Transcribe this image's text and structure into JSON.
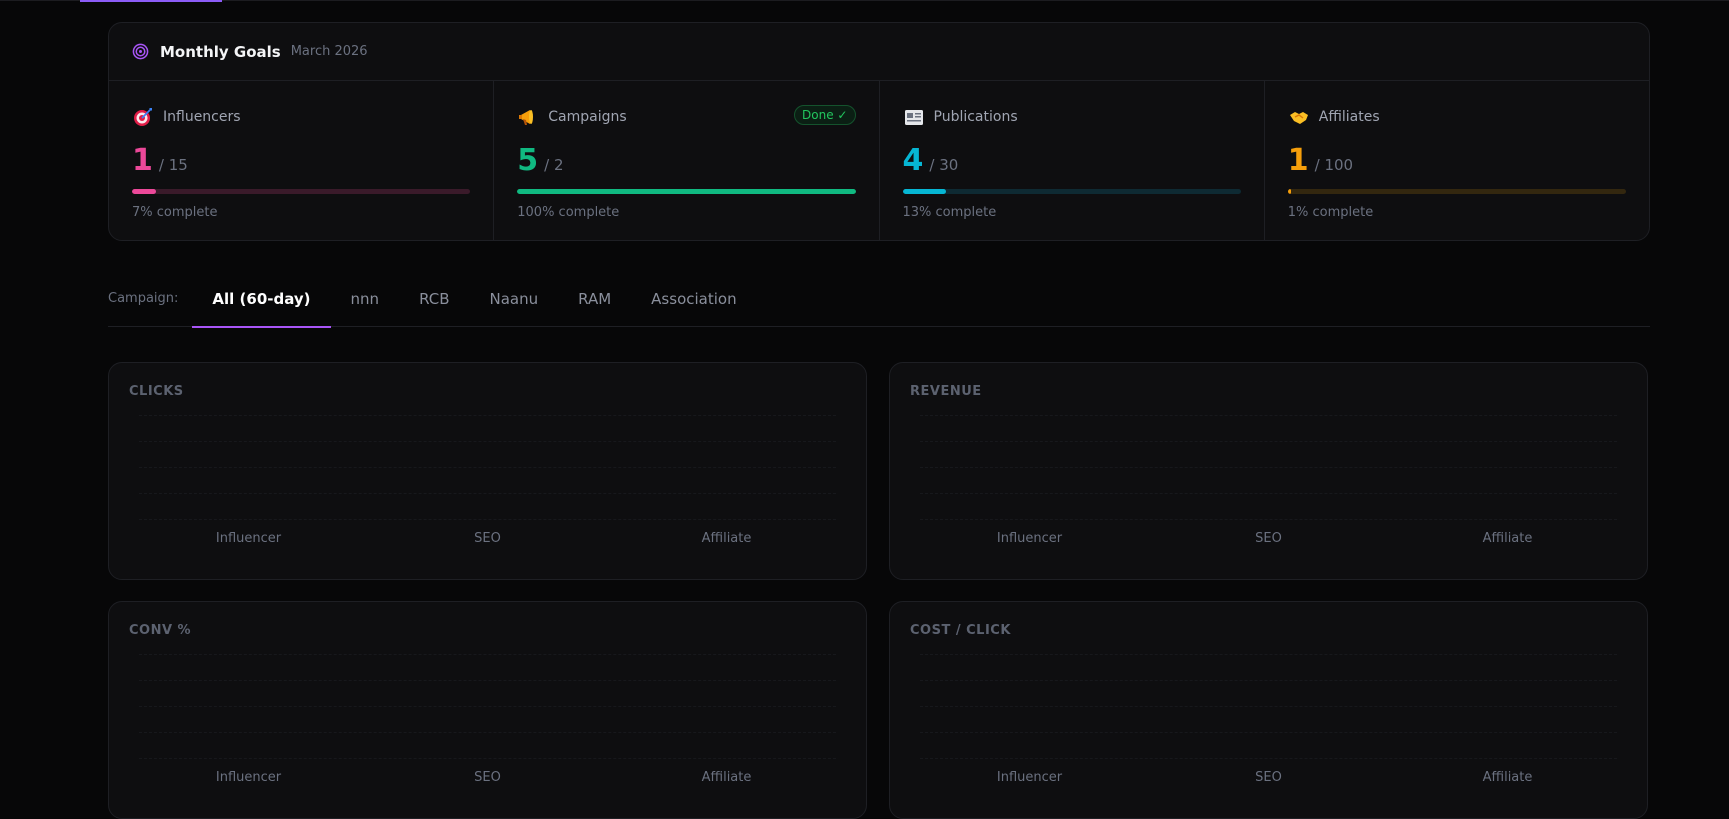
{
  "goals": {
    "title": "Monthly Goals",
    "date": "March 2026",
    "items": [
      {
        "label": "Influencers",
        "icon": "dart-target-icon",
        "current": "1",
        "target": "/ 15",
        "progress": 0.07,
        "complete_text": "7% complete",
        "color": "#ec4899",
        "track_color": "#3a1a2a",
        "badge": ""
      },
      {
        "label": "Campaigns",
        "icon": "megaphone-icon",
        "current": "5",
        "target": "/ 2",
        "progress": 1.0,
        "complete_text": "100% complete",
        "color": "#10b981",
        "track_color": "#0f3a2a",
        "badge": "Done ✓"
      },
      {
        "label": "Publications",
        "icon": "newspaper-icon",
        "current": "4",
        "target": "/ 30",
        "progress": 0.13,
        "complete_text": "13% complete",
        "color": "#06b6d4",
        "track_color": "#0e2a33",
        "badge": ""
      },
      {
        "label": "Affiliates",
        "icon": "handshake-icon",
        "current": "1",
        "target": "/ 100",
        "progress": 0.01,
        "complete_text": "1% complete",
        "color": "#f59e0b",
        "track_color": "#33270f",
        "badge": ""
      }
    ]
  },
  "campaign_tabs": {
    "label": "Campaign:",
    "tabs": [
      "All (60-day)",
      "nnn",
      "RCB",
      "Naanu",
      "RAM",
      "Association"
    ],
    "active": 0
  },
  "metrics": [
    {
      "title": "CLICKS",
      "categories": [
        "Influencer",
        "SEO",
        "Affiliate"
      ]
    },
    {
      "title": "REVENUE",
      "categories": [
        "Influencer",
        "SEO",
        "Affiliate"
      ]
    },
    {
      "title": "CONV %",
      "categories": [
        "Influencer",
        "SEO",
        "Affiliate"
      ]
    },
    {
      "title": "COST / CLICK",
      "categories": [
        "Influencer",
        "SEO",
        "Affiliate"
      ]
    }
  ],
  "accent": "#a855f7"
}
